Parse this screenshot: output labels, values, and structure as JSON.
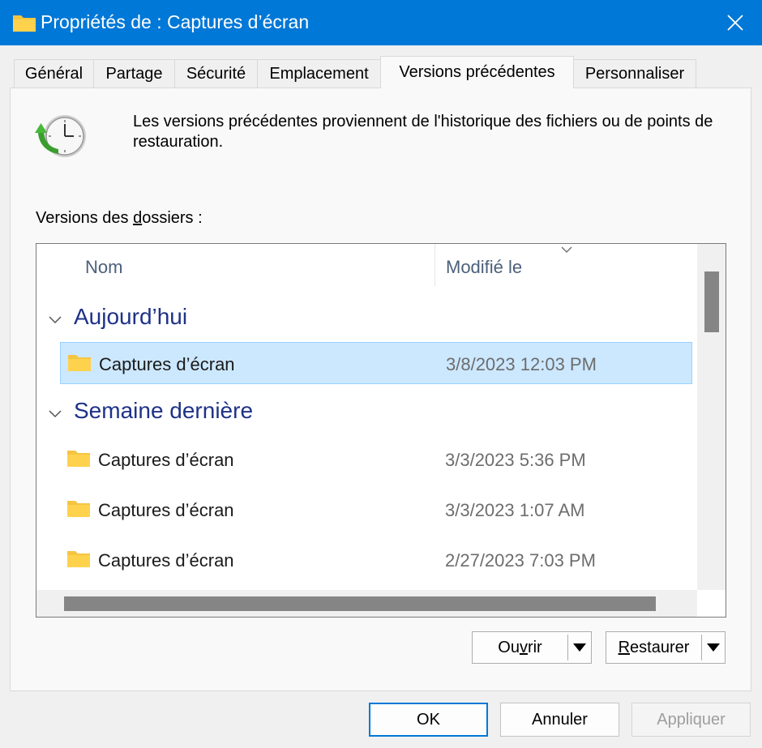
{
  "window": {
    "title": "Propriétés de : Captures d’écran",
    "folder_icon": "folder-icon",
    "close_icon": "close-icon"
  },
  "tabs": [
    {
      "label": "Général"
    },
    {
      "label": "Partage"
    },
    {
      "label": "Sécurité"
    },
    {
      "label": "Emplacement"
    },
    {
      "label": "Versions précédentes",
      "active": true
    },
    {
      "label": "Personnaliser"
    }
  ],
  "description": "Les versions précédentes proviennent de l'historique des fichiers ou de points de restauration.",
  "versions_label": {
    "before": "Versions des ",
    "accel": "d",
    "after": "ossiers :"
  },
  "list": {
    "columns": {
      "name": "Nom",
      "modified": "Modifié le"
    },
    "groups": [
      {
        "title": "Aujourd’hui",
        "items": [
          {
            "name": "Captures d’écran",
            "date": "3/8/2023 12:03 PM",
            "selected": true
          }
        ]
      },
      {
        "title": "Semaine dernière",
        "items": [
          {
            "name": "Captures d’écran",
            "date": "3/3/2023 5:36 PM"
          },
          {
            "name": "Captures d’écran",
            "date": "3/3/2023 1:07 AM"
          },
          {
            "name": "Captures d’écran",
            "date": "2/27/2023 7:03 PM"
          }
        ]
      }
    ]
  },
  "buttons": {
    "open": {
      "before": "Ou",
      "accel": "v",
      "after": "rir"
    },
    "restore": {
      "before": "",
      "accel": "R",
      "after": "estaurer"
    },
    "ok": "OK",
    "cancel": "Annuler",
    "apply": "Appliquer"
  },
  "colors": {
    "titlebar": "#0078d7",
    "group_header": "#1e3287",
    "selection": "#cce8ff",
    "folder": "#ffd24d"
  }
}
